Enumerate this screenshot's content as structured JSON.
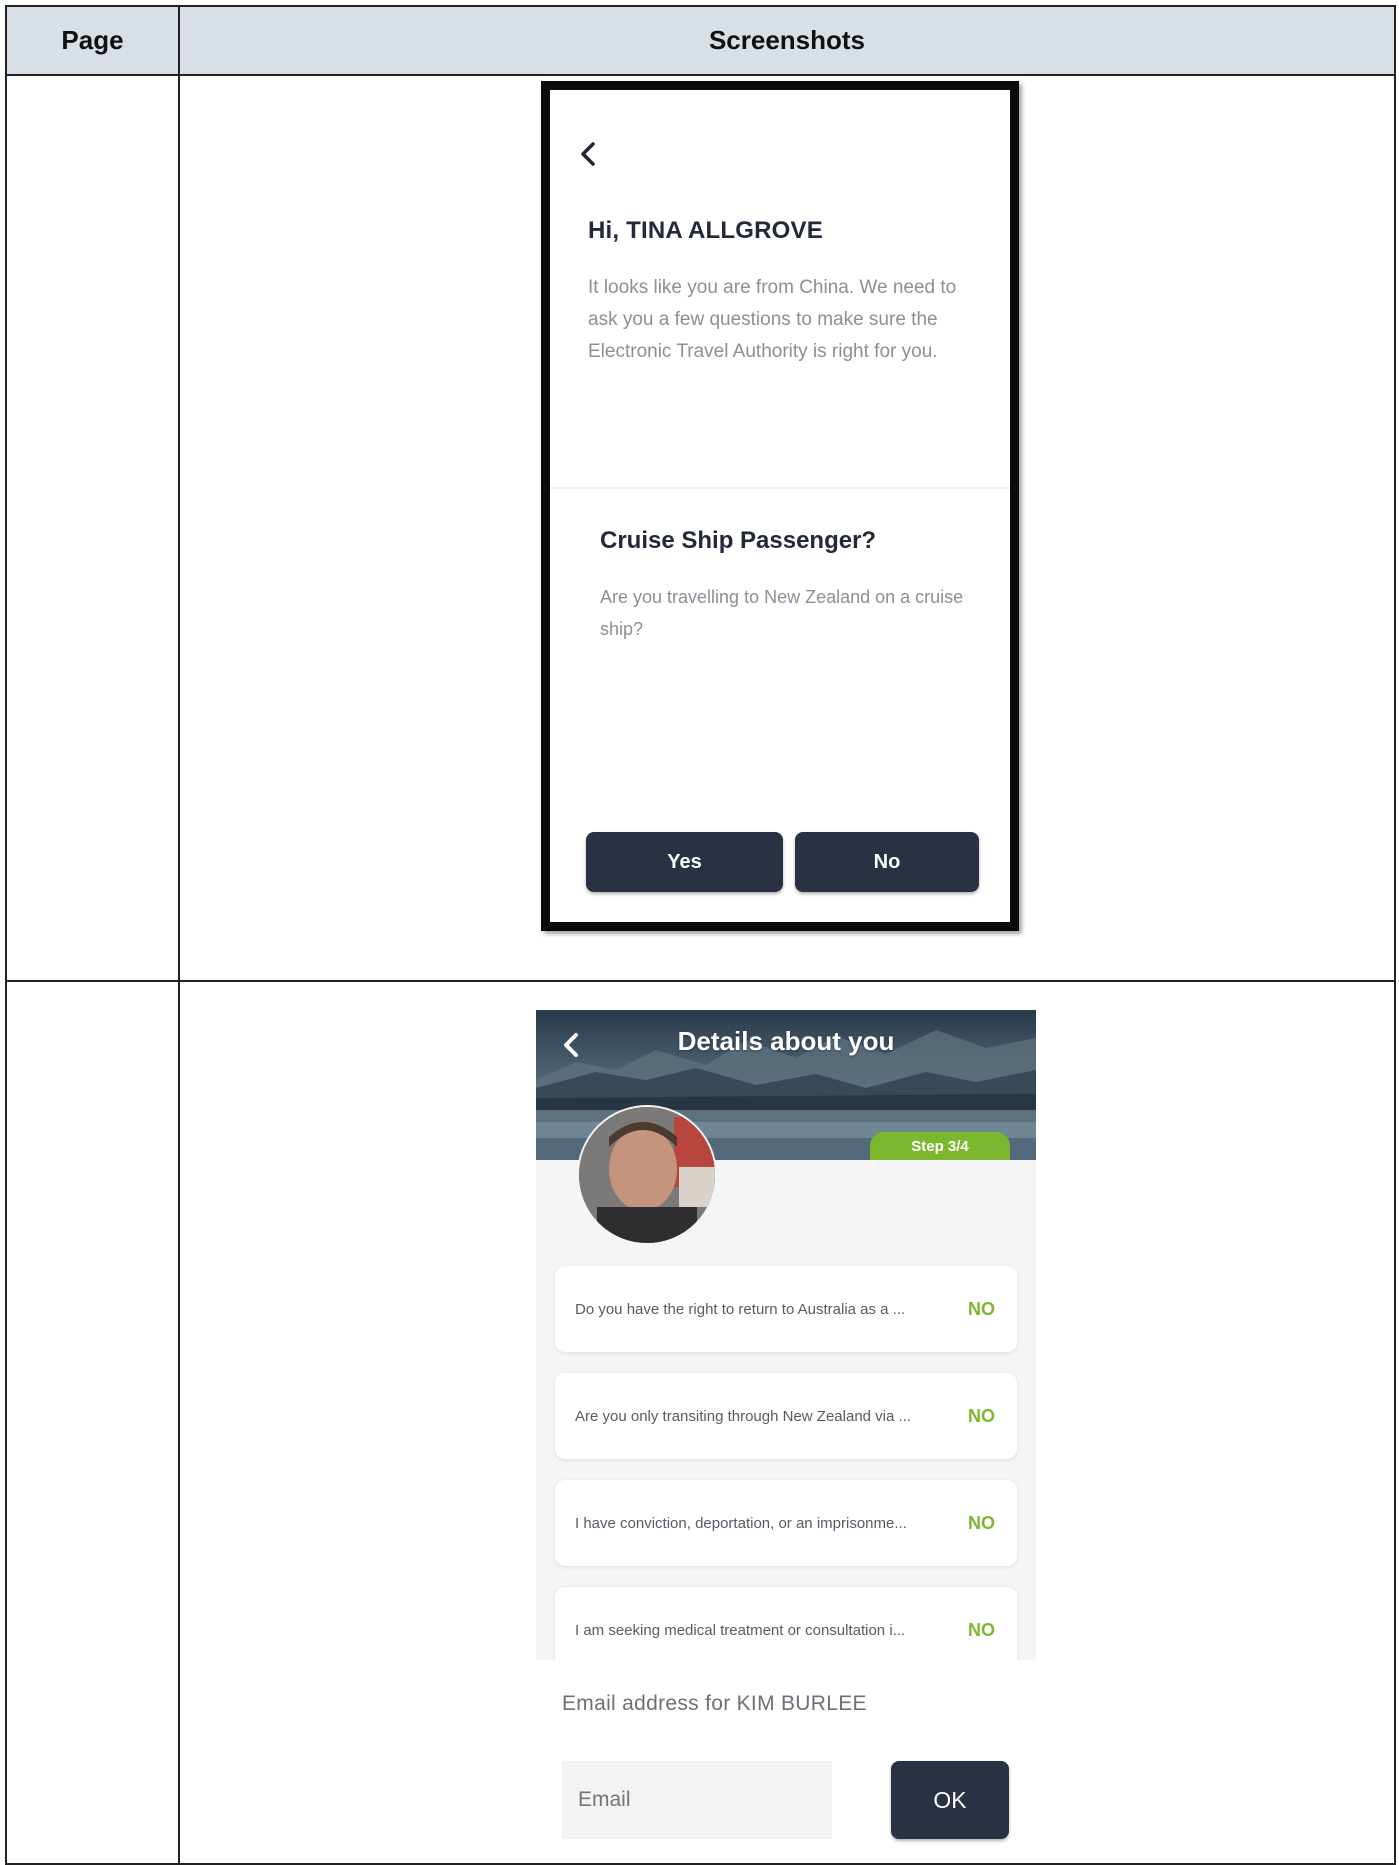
{
  "table": {
    "header_page": "Page",
    "header_screenshots": "Screenshots"
  },
  "screen1": {
    "back_icon": "chevron-left-icon",
    "greeting": "Hi, TINA ALLGROVE",
    "body": "It looks like you are from China. We need to ask you a few questions to make sure the Electronic Travel Authority is right for you.",
    "question_title": "Cruise Ship Passenger?",
    "question_body": "Are you travelling to New Zealand on a cruise ship?",
    "yes_label": "Yes",
    "no_label": "No"
  },
  "screen2": {
    "back_icon": "chevron-left-icon",
    "title": "Details about you",
    "step": "Step 3/4",
    "items": [
      {
        "text": "Do you have the right to return to Australia as a ...",
        "answer": "NO"
      },
      {
        "text": "Are you only transiting through New Zealand via ...",
        "answer": "NO"
      },
      {
        "text": "I have conviction, deportation, or an imprisonme...",
        "answer": "NO"
      },
      {
        "text": "I am seeking medical treatment or consultation i...",
        "answer": "NO"
      }
    ],
    "email_label": "Email address for KIM BURLEE",
    "email_placeholder": "Email",
    "ok_label": "OK",
    "colors": {
      "accent_green": "#7cb82f",
      "button_dark": "#2b3144"
    }
  }
}
